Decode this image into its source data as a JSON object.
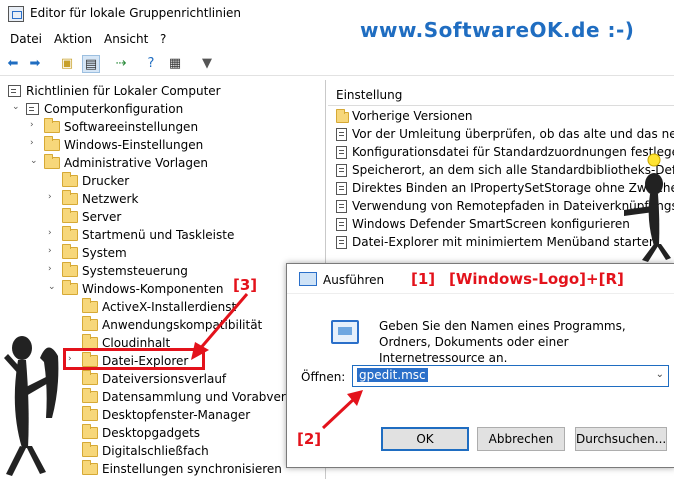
{
  "window": {
    "title": "Editor für lokale Gruppenrichtlinien",
    "brand": "www.SoftwareOK.de :-)"
  },
  "menu": [
    "Datei",
    "Aktion",
    "Ansicht",
    "?"
  ],
  "tree": {
    "root": "Richtlinien für Lokaler Computer",
    "items": [
      "Computerkonfiguration",
      "Softwareeinstellungen",
      "Windows-Einstellungen",
      "Administrative Vorlagen",
      "Drucker",
      "Netzwerk",
      "Server",
      "Startmenü und Taskleiste",
      "System",
      "Systemsteuerung",
      "Windows-Komponenten",
      "ActiveX-Installerdienst",
      "Anwendungskompatibilität",
      "Cloudinhalt",
      "Datei-Explorer",
      "Dateiversionsverlauf",
      "Datensammlung und Vorabversionen",
      "Desktopfenster-Manager",
      "Desktopgadgets",
      "Digitalschließfach",
      "Einstellungen synchronisieren"
    ]
  },
  "right": {
    "header": "Einstellung",
    "items": [
      "Vorherige Versionen",
      "Vor der Umleitung überprüfen, ob das alte und das neue Ziel",
      "Konfigurationsdatei für Standardzuordnungen festlegen",
      "Speicherort, an dem sich alle Standardbibliotheks-Definitionen",
      "Direktes Binden an IPropertySetStorage ohne Zwischenschicht",
      "Verwendung von Remotepfaden in Dateiverknüpfungsshortcuts",
      "Windows Defender SmartScreen konfigurieren",
      "Datei-Explorer mit minimiertem Menüband starten"
    ]
  },
  "dialog": {
    "title": "Ausführen",
    "description": "Geben Sie den Namen eines Programms, Ordners, Dokuments oder einer Internetressource an.",
    "open_label": "Öffnen:",
    "open_value": "gpedit.msc",
    "ok": "OK",
    "cancel": "Abbrechen",
    "browse": "Durchsuchen..."
  },
  "annotations": {
    "a1": "[1]",
    "a1_text": "[Windows-Logo]+[R]",
    "a2": "[2]",
    "a3": "[3]"
  },
  "colors": {
    "annotation": "#e3121b",
    "brand": "#1f6dc1"
  }
}
